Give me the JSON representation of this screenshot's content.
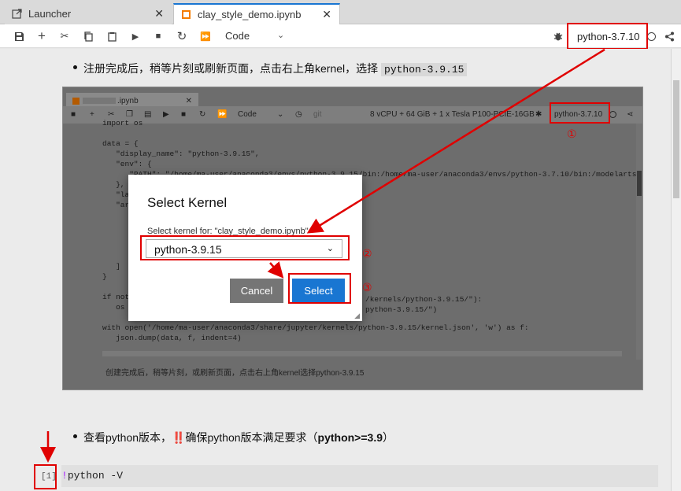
{
  "tabs": [
    {
      "label": "Launcher",
      "icon": "external-link-icon"
    },
    {
      "label": "clay_style_demo.ipynb",
      "icon": "notebook-icon"
    }
  ],
  "toolbar": {
    "cell_type": "Code",
    "kernel_name": "python-3.7.10"
  },
  "cell1": {
    "text_prefix": "注册完成后，稍等片刻或刷新页面，点击右上角kernel，选择",
    "code_value": "python-3.9.15"
  },
  "inner": {
    "tab_label": ".ipynb",
    "cell_type": "Code",
    "git": "git",
    "resources": "8 vCPU + 64 GiB + 1 x Tesla P100-PCIE-16GB",
    "kernel_name": "python-3.7.10",
    "code_lines": [
      "import os",
      "",
      "data = {",
      "   \"display_name\": \"python-3.9.15\",",
      "   \"env\": {",
      "      \"PATH\": \"/home/ma-user/anaconda3/envs/python-3.9.15/bin:/home/ma-user/anaconda3/envs/python-3.7.10/bin:/modelarts",
      "   },",
      "   \"la",
      "   \"ar",
      "",
      "",
      "",
      "",
      "",
      "   ]",
      "}",
      "",
      "if not",
      "   os",
      "",
      "with open('/home/ma-user/anaconda3/share/jupyter/kernels/python-3.9.15/kernel.json', 'w') as f:",
      "   json.dump(data, f, indent=4)"
    ],
    "code_right_1": "/kernels/python-3.9.15/\"):",
    "code_right_2": "python-3.9.15/\")",
    "caption": "创建完成后，稍等片刻，或刷新页面，点击右上角kernel选择python-3.9.15"
  },
  "modal": {
    "title": "Select Kernel",
    "label": "Select kernel for: \"clay_style_demo.ipynb\"",
    "selected": "python-3.9.15",
    "cancel": "Cancel",
    "select": "Select"
  },
  "annotations": {
    "n1": "①",
    "n2": "②",
    "n3": "③"
  },
  "cell2": {
    "text_a": "查看python版本，",
    "warn": "‼️",
    "text_b": "确保python版本满足要求（",
    "bold": "python>=3.9",
    "text_c": "）"
  },
  "cell3": {
    "prompt": "[1]",
    "bang": "!",
    "command": "python -V"
  },
  "colors": {
    "accent": "#1976d2",
    "annotation_red": "#e00000"
  }
}
